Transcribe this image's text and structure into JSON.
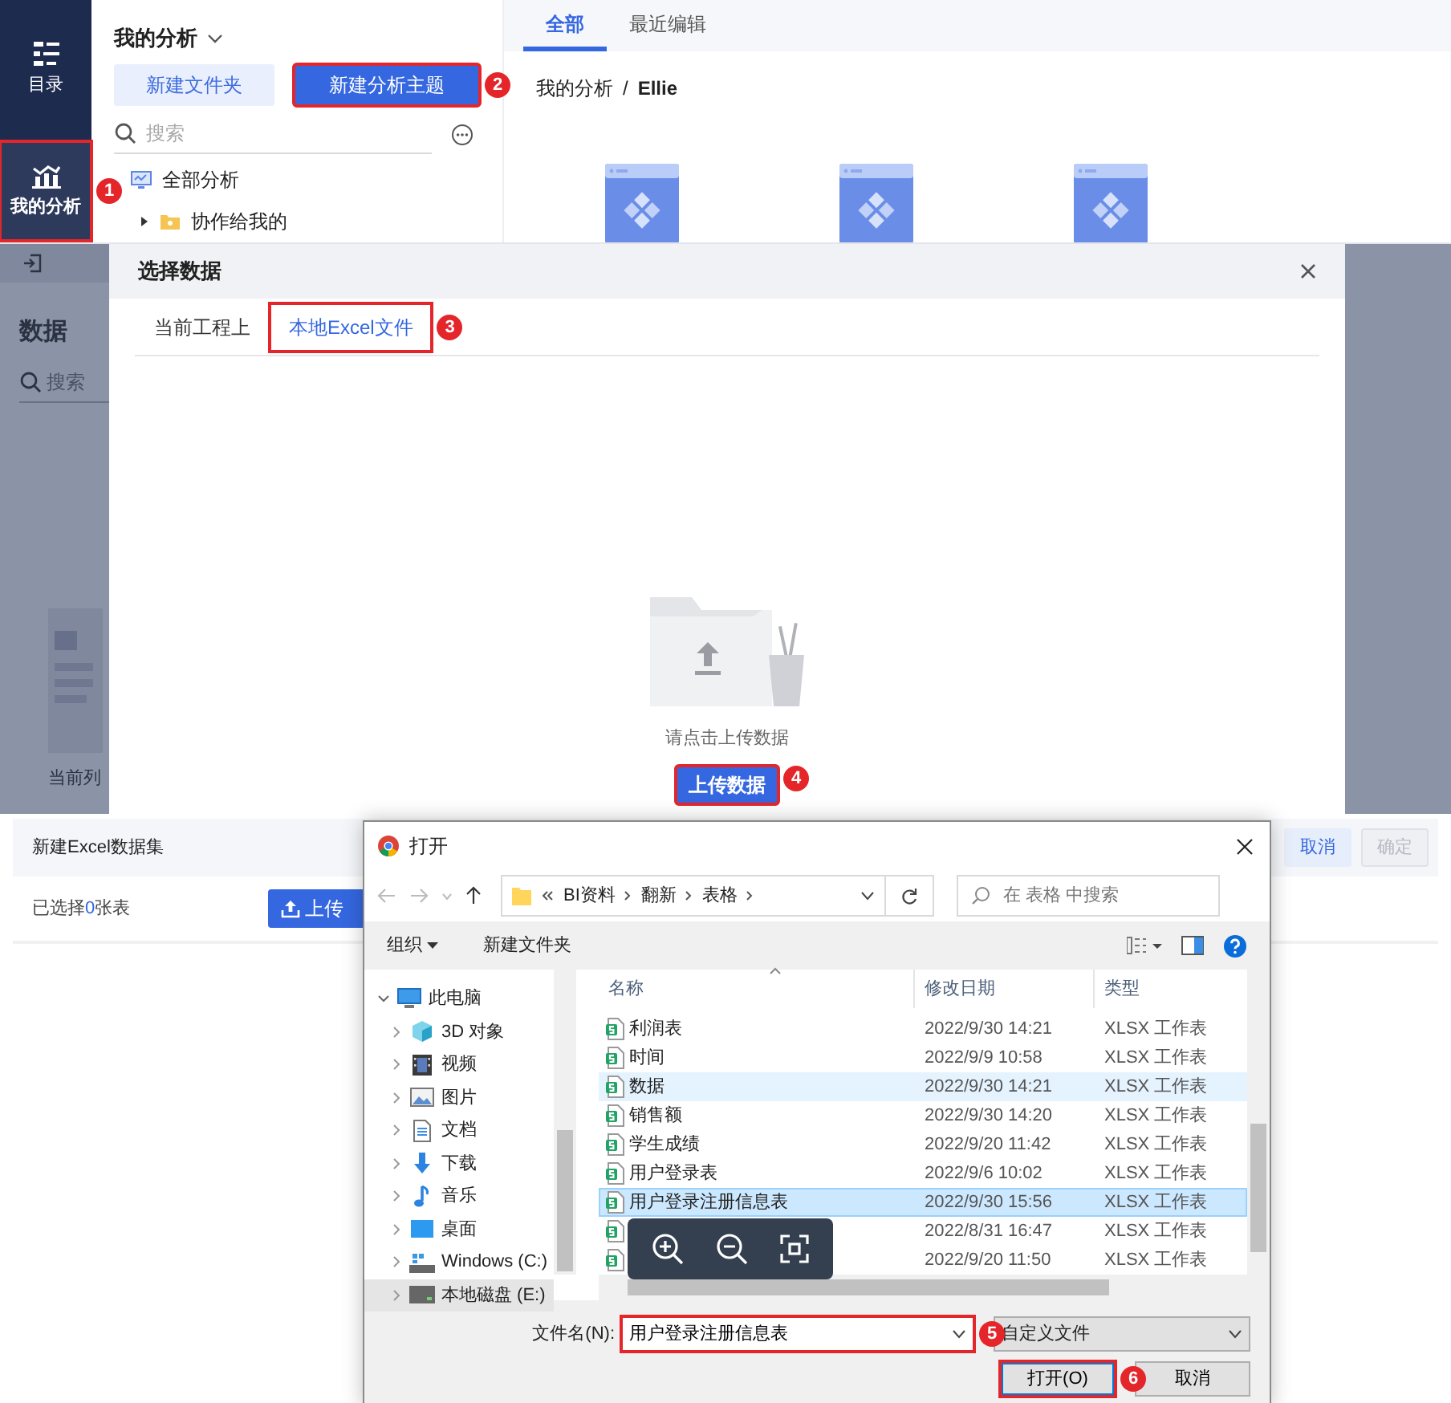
{
  "top": {
    "nav": [
      {
        "label": "目录",
        "kind": "catalog",
        "selected": false
      },
      {
        "label": "我的分析",
        "kind": "analysis",
        "selected": true,
        "marker": "1"
      }
    ],
    "panel": {
      "title": "我的分析",
      "buttons": [
        {
          "label": "新建文件夹",
          "kind": "secondary"
        },
        {
          "label": "新建分析主题",
          "kind": "primary",
          "marker": "2"
        }
      ],
      "search": {
        "placeholder": "搜索"
      },
      "tree": [
        {
          "label": "全部分析",
          "kind": "all"
        },
        {
          "label": "协作给我的",
          "kind": "folder",
          "expanded": false
        }
      ]
    },
    "tabs": [
      {
        "label": "全部",
        "selected": true
      },
      {
        "label": "最近编辑",
        "selected": false
      }
    ],
    "breadcrumb": {
      "items": [
        "我的分析",
        "Ellie"
      ],
      "separator": "/"
    },
    "cards": [
      {
        "kind": "theme"
      },
      {
        "kind": "theme"
      },
      {
        "kind": "theme"
      }
    ]
  },
  "middle": {
    "background": {
      "title": "数据",
      "search": {
        "placeholder": "搜索"
      },
      "list_label": "当前列"
    },
    "modal": {
      "title": "选择数据",
      "tabs": [
        {
          "label": "当前工程上",
          "selected": false
        },
        {
          "label": "本地Excel文件",
          "selected": true,
          "marker": "3"
        }
      ],
      "hint": "请点击上传数据",
      "upload_button": {
        "label": "上传数据",
        "marker": "4"
      }
    }
  },
  "bottom": {
    "panel": {
      "title": "新建Excel数据集",
      "selection": {
        "before": "已选择",
        "count": "0",
        "after": "张表"
      },
      "upload_button": "上传",
      "buttons": [
        {
          "label": "取消",
          "disabled": false
        },
        {
          "label": "确定",
          "disabled": true
        }
      ]
    },
    "open_dialog": {
      "title": "打开",
      "path": [
        "BI资料",
        "翻新",
        "表格"
      ],
      "search": {
        "placeholder": "在 表格 中搜索"
      },
      "toolbar": [
        "组织",
        "新建文件夹"
      ],
      "tree": [
        {
          "label": "此电脑",
          "kind": "pc",
          "expanded": true,
          "selected": false,
          "children": [
            {
              "label": "3D 对象",
              "kind": "cube",
              "expanded": false,
              "selected": false
            },
            {
              "label": "视频",
              "kind": "video",
              "expanded": false,
              "selected": false
            },
            {
              "label": "图片",
              "kind": "picture",
              "expanded": false,
              "selected": false
            },
            {
              "label": "文档",
              "kind": "doc",
              "expanded": false,
              "selected": false
            },
            {
              "label": "下载",
              "kind": "download",
              "expanded": false,
              "selected": false
            },
            {
              "label": "音乐",
              "kind": "music",
              "expanded": false,
              "selected": false
            },
            {
              "label": "桌面",
              "kind": "desktop",
              "expanded": false,
              "selected": false
            },
            {
              "label": "Windows (C:)",
              "kind": "system-drive",
              "expanded": false,
              "selected": false
            },
            {
              "label": "本地磁盘 (E:)",
              "kind": "drive",
              "expanded": false,
              "selected": true
            }
          ]
        }
      ],
      "columns": [
        "名称",
        "修改日期",
        "类型"
      ],
      "files": [
        {
          "name": "利润表",
          "date": "2022/9/30 14:21",
          "type": "XLSX 工作表",
          "selected": false,
          "hovered": false
        },
        {
          "name": "时间",
          "date": "2022/9/9 10:58",
          "type": "XLSX 工作表",
          "selected": false,
          "hovered": false
        },
        {
          "name": "数据",
          "date": "2022/9/30 14:21",
          "type": "XLSX 工作表",
          "selected": false,
          "hovered": true
        },
        {
          "name": "销售额",
          "date": "2022/9/30 14:20",
          "type": "XLSX 工作表",
          "selected": false,
          "hovered": false
        },
        {
          "name": "学生成绩",
          "date": "2022/9/20 11:42",
          "type": "XLSX 工作表",
          "selected": false,
          "hovered": false
        },
        {
          "name": "用户登录表",
          "date": "2022/9/6 10:02",
          "type": "XLSX 工作表",
          "selected": false,
          "hovered": false
        },
        {
          "name": "用户登录注册信息表",
          "date": "2022/9/30 15:56",
          "type": "XLSX 工作表",
          "selected": true,
          "hovered": false
        },
        {
          "date": "2022/8/31 16:47",
          "type": "XLSX 工作表",
          "selected": false,
          "hovered": false
        },
        {
          "date": "2022/9/20 11:50",
          "type": "XLSX 工作表",
          "selected": false,
          "hovered": false
        }
      ],
      "filename": {
        "label": "文件名(N):",
        "value": "用户登录注册信息表",
        "marker": "5"
      },
      "filter": "自定义文件",
      "buttons": [
        {
          "label": "打开(O)",
          "kind": "primary",
          "marker": "6"
        },
        {
          "label": "取消",
          "kind": "default"
        }
      ]
    }
  }
}
